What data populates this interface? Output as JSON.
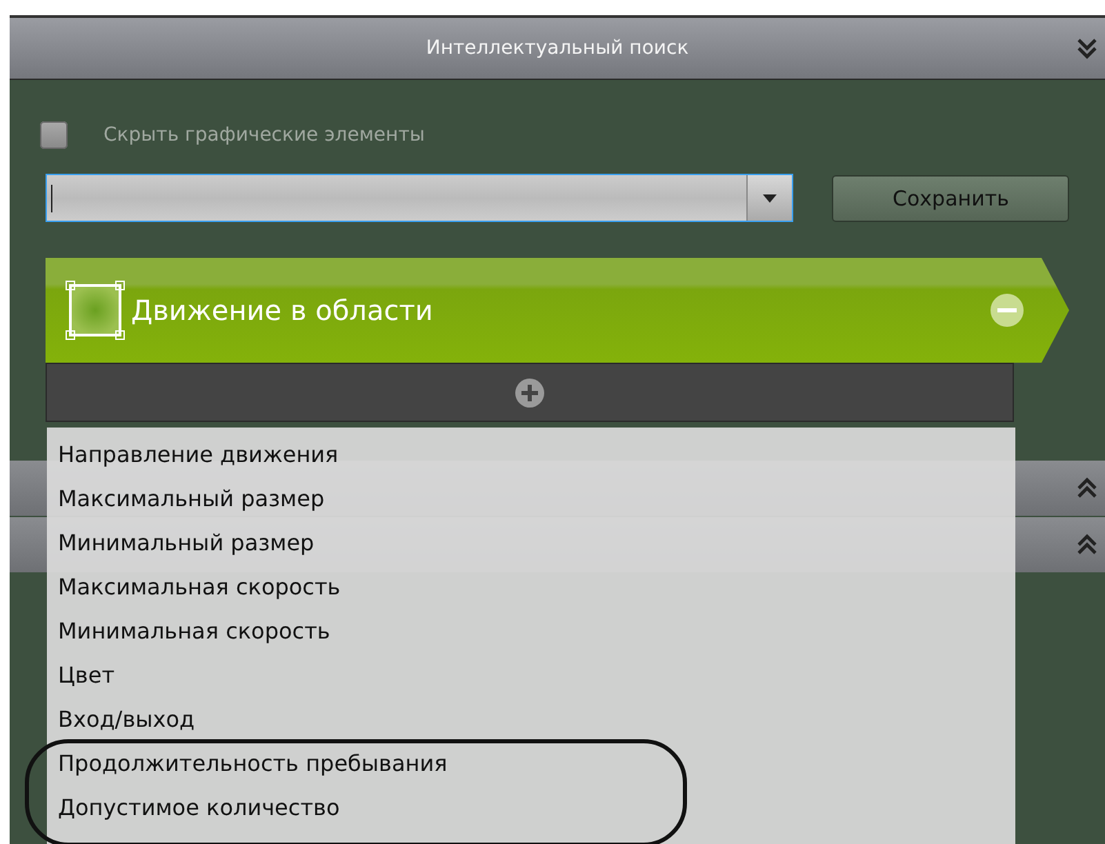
{
  "panel": {
    "title": "Интеллектуальный поиск"
  },
  "hide_graphics": {
    "label": "Скрыть графические элементы",
    "checked": false
  },
  "save_button": "Сохранить",
  "detector": {
    "title": "Движение в области"
  },
  "collapsed_panels": [
    {
      "expanded": false
    },
    {
      "expanded": false
    }
  ],
  "menu": {
    "items": [
      {
        "label": "Направление движения",
        "circled": false
      },
      {
        "label": "Максимальный размер",
        "circled": false
      },
      {
        "label": "Минимальный размер",
        "circled": false
      },
      {
        "label": "Максимальная скорость",
        "circled": false
      },
      {
        "label": "Минимальная скорость",
        "circled": false
      },
      {
        "label": "Цвет",
        "circled": false
      },
      {
        "label": "Вход/выход",
        "circled": false
      },
      {
        "label": "Продолжительность пребывания",
        "circled": true
      },
      {
        "label": "Допустимое количество",
        "circled": true
      }
    ]
  }
}
